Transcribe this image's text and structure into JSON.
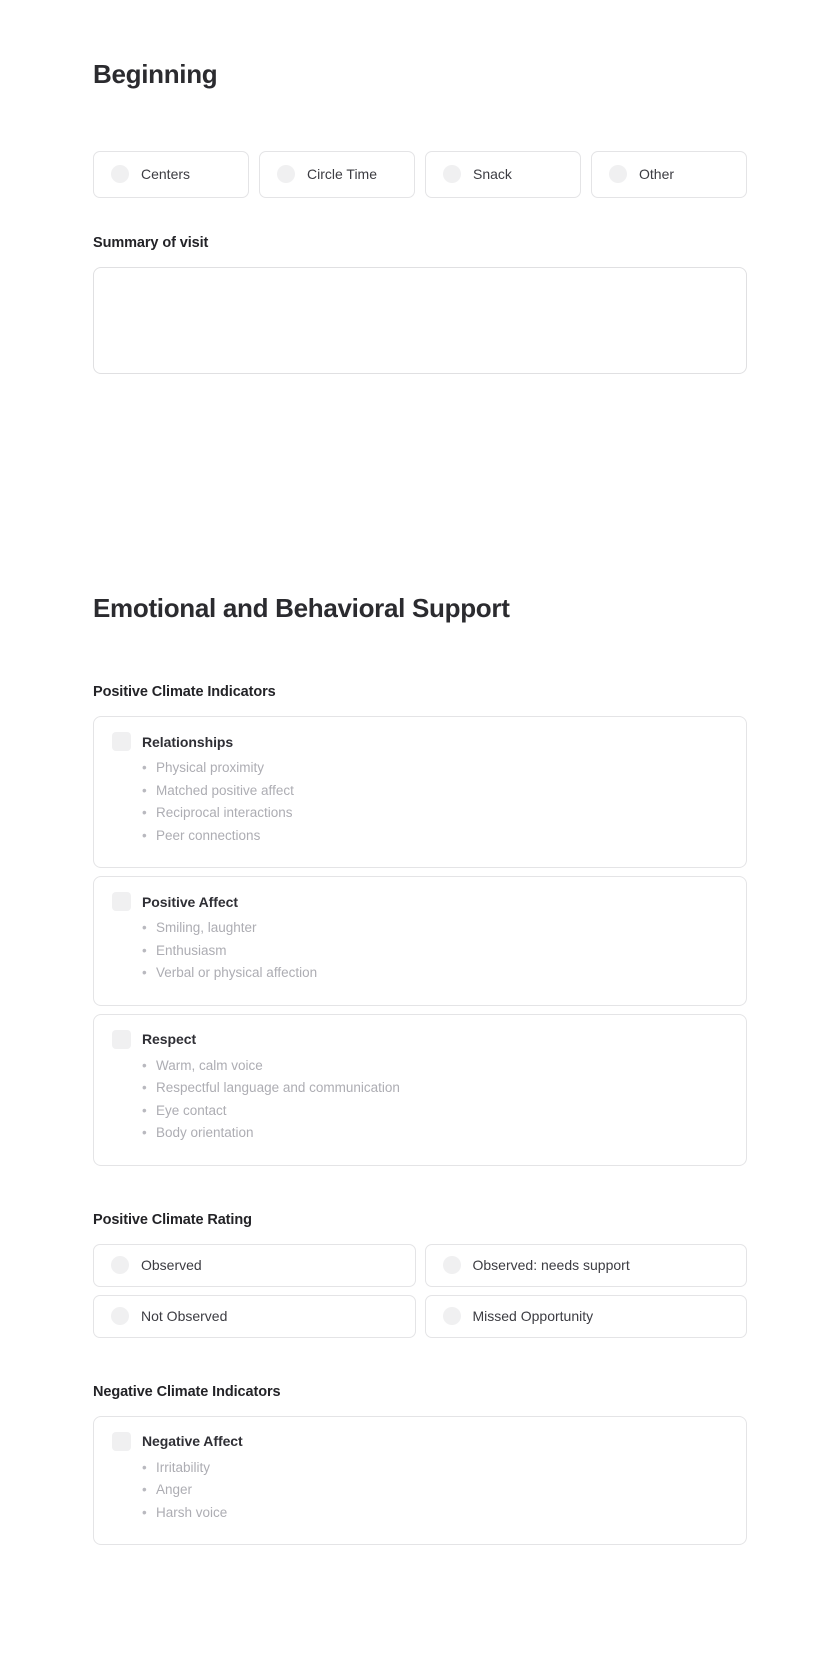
{
  "sections": [
    {
      "id": "beginning",
      "title": "Beginning",
      "activity_options": [
        {
          "label": "Centers",
          "selected": false
        },
        {
          "label": "Circle Time",
          "selected": false
        },
        {
          "label": "Snack",
          "selected": false
        },
        {
          "label": "Other",
          "selected": false
        }
      ],
      "summary": {
        "label": "Summary of visit",
        "value": "",
        "placeholder": ""
      }
    },
    {
      "id": "emotional-behavioral-support",
      "title": "Emotional and Behavioral Support",
      "groups": [
        {
          "id": "positive-climate-indicators",
          "label": "Positive Climate Indicators",
          "cards": [
            {
              "title": "Relationships",
              "checked": false,
              "items": [
                "Physical proximity",
                "Matched positive affect",
                "Reciprocal interactions",
                "Peer connections"
              ]
            },
            {
              "title": "Positive Affect",
              "checked": false,
              "items": [
                "Smiling, laughter",
                "Enthusiasm",
                "Verbal or physical affection"
              ]
            },
            {
              "title": "Respect",
              "checked": false,
              "items": [
                "Warm, calm voice",
                "Respectful language and communication",
                "Eye contact",
                "Body orientation"
              ]
            }
          ]
        },
        {
          "id": "positive-climate-rating",
          "label": "Positive Climate Rating",
          "ratings": [
            {
              "label": "Observed",
              "selected": false
            },
            {
              "label": "Observed: needs support",
              "selected": false
            },
            {
              "label": "Not Observed",
              "selected": false
            },
            {
              "label": "Missed Opportunity",
              "selected": false
            }
          ]
        },
        {
          "id": "negative-climate-indicators",
          "label": "Negative Climate Indicators",
          "cards": [
            {
              "title": "Negative Affect",
              "checked": false,
              "items": [
                "Irritability",
                "Anger",
                "Harsh voice"
              ]
            }
          ]
        }
      ]
    }
  ],
  "colors": {
    "page_background": "#ffffff",
    "heading_text": "#2b2b2f",
    "label_text": "#232327",
    "body_text": "#3c3c42",
    "muted_text": "#adadb3",
    "card_border": "#e4e4e6",
    "control_fill": "#f0f0f1"
  }
}
